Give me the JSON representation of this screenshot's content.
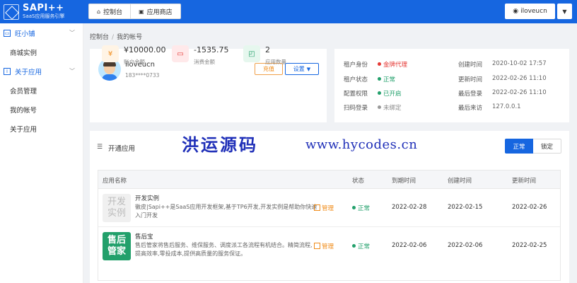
{
  "brand": {
    "title": "SAPI++",
    "subtitle": "SaaS应用服务引擎"
  },
  "topnav": {
    "console": "控制台",
    "app_store": "应用商店"
  },
  "user": {
    "name": "iloveucn"
  },
  "sidebar": {
    "group1": "旺小铺",
    "group1_items": [
      "商城实例"
    ],
    "group2": "关于应用",
    "group2_items": [
      "会员管理",
      "我的帐号",
      "关于应用"
    ]
  },
  "breadcrumb": {
    "home": "控制台",
    "current": "我的帐号"
  },
  "profile": {
    "username": "iloveucn",
    "phone": "183****0733",
    "recharge": "充值",
    "settings": "设置",
    "balance_value": "¥10000.00",
    "balance_label": "账户余额",
    "consume_value": "-1535.75",
    "consume_label": "消费金额",
    "apps_value": "2",
    "apps_label": "应用数量"
  },
  "account_info": {
    "identity_label": "租户身份",
    "identity_value": "金牌代理",
    "status_label": "租户状态",
    "status_value": "正常",
    "perm_label": "配置权限",
    "perm_value": "已开启",
    "scan_label": "扫码登录",
    "scan_value": "未绑定",
    "created_label": "创建时间",
    "created_value": "2020-10-02 17:57",
    "updated_label": "更新时间",
    "updated_value": "2022-02-26 11:10",
    "last_login_label": "最后登录",
    "last_login_value": "2022-02-26 11:10",
    "last_from_label": "最后来访",
    "last_from_value": "127.0.0.1"
  },
  "apps": {
    "title": "开通应用",
    "watermark": "洪运源码",
    "watermark_url": "www.hycodes.cn",
    "filter_normal": "正常",
    "filter_locked": "锁定",
    "columns": [
      "应用名称",
      "状态",
      "到期时间",
      "创建时间",
      "更新时间"
    ],
    "rows": [
      {
        "thumb": "开发实例",
        "name": "开发实例",
        "desc": "徽皮|Sapi++是SaaS应用开发框架,基于TP6开发,开发实例是帮助你快速入门开发",
        "manage": "管理",
        "status": "正常",
        "expire": "2022-02-28",
        "created": "2022-02-15",
        "updated": "2022-02-26"
      },
      {
        "thumb": "售后管家",
        "name": "售后宝",
        "desc": "售后管家将售后服务、维保服务、调度派工各流程有机结合。精简流程,提高效率,零投成本,提供高质量的服务保证。",
        "manage": "管理",
        "status": "正常",
        "expire": "2022-02-06",
        "created": "2022-02-06",
        "updated": "2022-02-25"
      }
    ]
  },
  "colors": {
    "primary": "#1666e0",
    "gold": "#e53935",
    "success": "#22a06b",
    "muted": "#999999",
    "warning": "#f08c1a"
  }
}
